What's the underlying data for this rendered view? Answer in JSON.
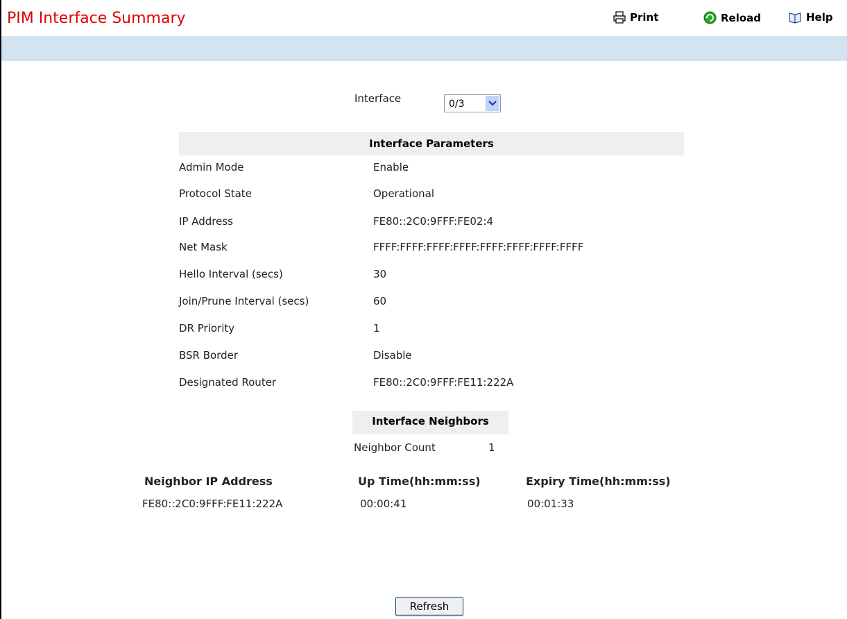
{
  "header": {
    "title": "PIM Interface Summary",
    "print_label": "Print",
    "reload_label": "Reload",
    "help_label": "Help"
  },
  "interface": {
    "label": "Interface",
    "selected": "0/3"
  },
  "parameters": {
    "heading": "Interface Parameters",
    "rows": [
      {
        "label": "Admin Mode",
        "value": "Enable"
      },
      {
        "label": "Protocol State",
        "value": "Operational"
      },
      {
        "label": "IP Address",
        "value": "FE80::2C0:9FFF:FE02:4"
      },
      {
        "label": "Net Mask",
        "value": "FFFF:FFFF:FFFF:FFFF:FFFF:FFFF:FFFF:FFFF"
      },
      {
        "label": "Hello Interval (secs)",
        "value": "30"
      },
      {
        "label": "Join/Prune Interval (secs)",
        "value": "60"
      },
      {
        "label": "DR Priority",
        "value": "1"
      },
      {
        "label": "BSR Border",
        "value": "Disable"
      },
      {
        "label": "Designated Router",
        "value": "FE80::2C0:9FFF:FE11:222A"
      }
    ]
  },
  "neighbors": {
    "heading": "Interface Neighbors",
    "count_label": "Neighbor Count",
    "count_value": "1",
    "columns": [
      "Neighbor IP Address",
      "Up Time(hh:mm:ss)",
      "Expiry Time(hh:mm:ss)"
    ],
    "rows": [
      [
        "FE80::2C0:9FFF:FE11:222A",
        "00:00:41",
        "00:01:33"
      ]
    ]
  },
  "footer": {
    "refresh_label": "Refresh"
  },
  "colors": {
    "title": "#e00000",
    "band": "#d3e3f0",
    "section_bg": "#efefef"
  }
}
